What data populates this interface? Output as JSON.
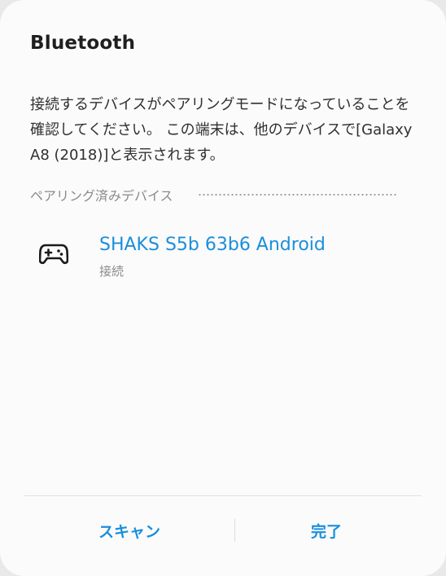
{
  "dialog": {
    "title": "Bluetooth",
    "description": "接続するデバイスがペアリングモードになっていることを確認してください。 この端末は、他のデバイスで[Galaxy A8 (2018)]と表示されます。"
  },
  "paired_section": {
    "label": "ペアリング済みデバイス",
    "loading_indicator": "dotted-progress"
  },
  "devices": [
    {
      "icon": "gamepad-icon",
      "name": "SHAKS S5b 63b6 Android",
      "status": "接続"
    }
  ],
  "buttons": {
    "scan": "スキャン",
    "done": "完了"
  },
  "colors": {
    "accent": "#1a8fdc",
    "title": "#1f1f1f",
    "body_text": "#303030",
    "secondary_text": "#8a8a8a",
    "dialog_bg": "#fbfbfb"
  }
}
